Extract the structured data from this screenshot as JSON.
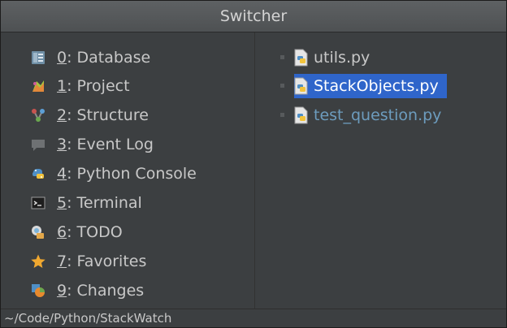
{
  "window": {
    "title": "Switcher"
  },
  "tool_windows": [
    {
      "number": "0",
      "rest": ": Database",
      "icon": "database-icon"
    },
    {
      "number": "1",
      "rest": ": Project",
      "icon": "project-icon"
    },
    {
      "number": "2",
      "rest": ": Structure",
      "icon": "structure-icon"
    },
    {
      "number": "3",
      "rest": ": Event Log",
      "icon": "event-log-icon"
    },
    {
      "number": "4",
      "rest": ": Python Console",
      "icon": "python-console-icon"
    },
    {
      "number": "5",
      "rest": ": Terminal",
      "icon": "terminal-icon"
    },
    {
      "number": "6",
      "rest": ": TODO",
      "icon": "todo-icon"
    },
    {
      "number": "7",
      "rest": ": Favorites",
      "icon": "favorites-icon"
    },
    {
      "number": "9",
      "rest": ": Changes",
      "icon": "changes-icon"
    }
  ],
  "files": [
    {
      "name": "utils.py",
      "icon": "python-file-icon",
      "selected": false
    },
    {
      "name": "StackObjects.py",
      "icon": "python-file-icon",
      "selected": true
    },
    {
      "name": "test_question.py",
      "icon": "python-file-icon",
      "selected": false
    }
  ],
  "status": {
    "path": "~/Code/Python/StackWatch"
  },
  "colors": {
    "background": "#3c3f41",
    "selection": "#2f65ca",
    "test_file_text": "#6d9cbe"
  }
}
